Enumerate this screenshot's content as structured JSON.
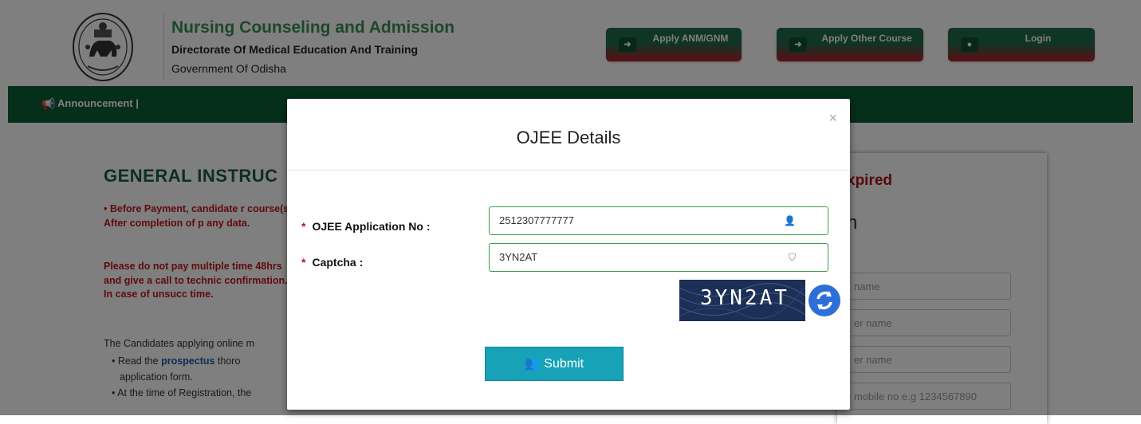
{
  "header": {
    "title": "Nursing Counseling and Admission",
    "subtitle": "Directorate Of Medical Education And Training",
    "org": "Government Of Odisha",
    "buttons": [
      {
        "label": "Apply ANM/GNM"
      },
      {
        "label": "Apply Other Course"
      },
      {
        "label": "Login"
      }
    ]
  },
  "nav": {
    "announcement": "Announcement  |"
  },
  "background": {
    "title": "GENERAL INSTRUC",
    "red_para_1": "• Before Payment, candidate r course(s). After completion of p any data.",
    "red_para_2": "Please do not pay multiple time 48hrs and give a call to technic confirmation. In case of unsucc time.",
    "gray_para": "The Candidates applying online m",
    "bullet_1_pre": "• Read the ",
    "bullet_1_link": "prospectus",
    "bullet_1_post": " thoro",
    "bullet_1_cont": "application form.",
    "bullet_2": "• At the time of Registration, the",
    "right_expired": "xpired",
    "right_letter": "n",
    "right_inputs": [
      "name",
      "er name",
      "er name",
      "mobile no e.g 1234567890"
    ]
  },
  "modal": {
    "title": "OJEE Details",
    "close": "×",
    "fields": [
      {
        "label": "OJEE Application No :",
        "value": "2512307777777"
      },
      {
        "label": "Captcha :",
        "value": "3YN2AT"
      }
    ],
    "captcha_image_text": "3YN2AT",
    "submit_label": "Submit"
  },
  "colors": {
    "brand_green": "#3a8f58",
    "nav_green": "#0b5c37",
    "accent_red": "#c0161c",
    "submit_teal": "#17a2b8",
    "input_border": "#3d9b4d"
  }
}
